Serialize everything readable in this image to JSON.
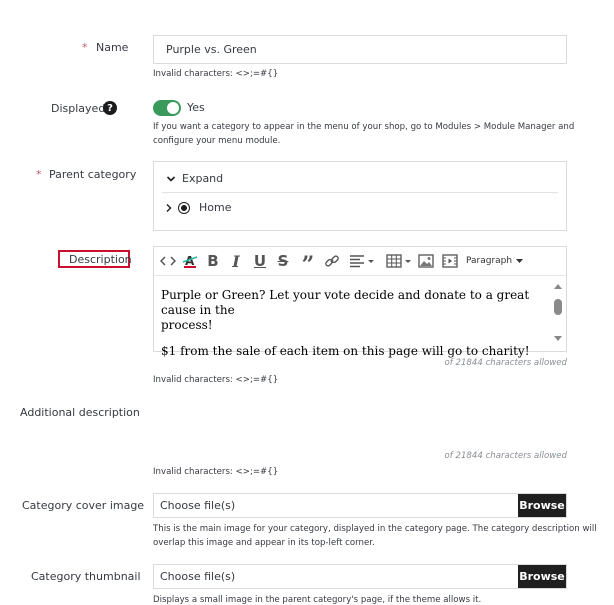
{
  "name": {
    "label": "Name",
    "value": "Purple vs. Green",
    "hint": "Invalid characters: <>;=#{}"
  },
  "displayed": {
    "label": "Displayed",
    "toggle_label": "Yes",
    "toggle_on": true,
    "hint_line1": "If you want a category to appear in the menu of your shop, go to Modules > Module Manager and",
    "hint_line2": "configure your menu module."
  },
  "parent_category": {
    "label": "Parent category",
    "expand_label": "Expand",
    "tree_item": "Home"
  },
  "description": {
    "label": "Description",
    "toolbar_paragraph": "Paragraph",
    "para1_line1": "Purple or Green? Let your vote decide and donate to a great cause in the",
    "para1_line2": "process!",
    "para2": "$1 from the sale of each item on this page will go to charity!",
    "allowed": "of 21844 characters allowed",
    "hint": "Invalid characters: <>;=#{}"
  },
  "additional_description": {
    "label": "Additional description",
    "allowed": "of 21844 characters allowed",
    "hint": "Invalid characters: <>;=#{}"
  },
  "cover_image": {
    "label": "Category cover image",
    "placeholder": "Choose file(s)",
    "button": "Browse",
    "hint_line1": "This is the main image for your category, displayed in the category page. The category description will",
    "hint_line2": "overlap this image and appear in its top-left corner."
  },
  "thumbnail": {
    "label": "Category thumbnail",
    "placeholder": "Choose file(s)",
    "button": "Browse",
    "hint": "Displays a small image in the parent category's page, if the theme allows it."
  },
  "colors": {
    "accent_green": "#25b9a4",
    "toggle_green": "#3a9a5b",
    "highlight_red": "#c8102e"
  }
}
